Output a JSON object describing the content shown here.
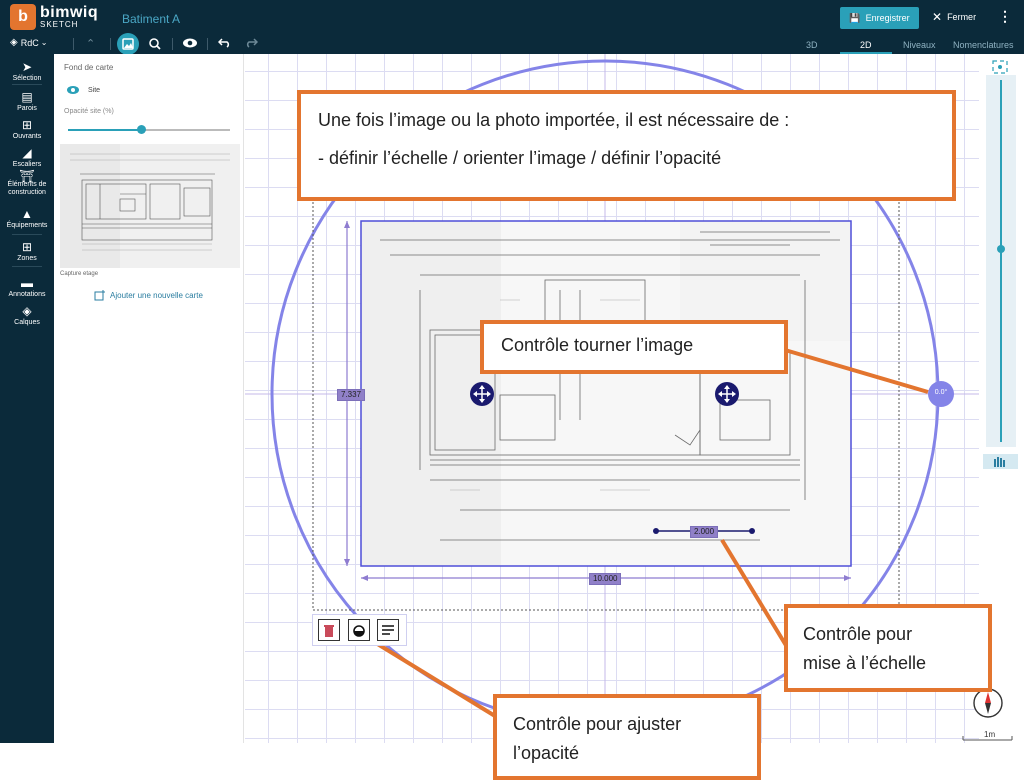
{
  "app": {
    "brand": "bimwiq",
    "brand_sub": "SKETCH",
    "project": "Batiment A"
  },
  "header": {
    "save_label": "Enregistrer",
    "close_label": "Fermer",
    "menu_icon": "kebab-icon"
  },
  "toolbar": {
    "level_select": "RdC"
  },
  "view_tabs": {
    "t3d": "3D",
    "t2d": "2D",
    "levels": "Niveaux",
    "nomenclatures": "Nomenclatures"
  },
  "rail": {
    "selection": "Sélection",
    "parois": "Parois",
    "ouvrants": "Ouvrants",
    "escaliers": "Escaliers",
    "elements1": "Éléments de",
    "elements2": "construction",
    "equipements": "Équipements",
    "zones": "Zones",
    "annotations": "Annotations",
    "calques": "Calques"
  },
  "panel": {
    "title": "Fond de carte",
    "site_label": "Site",
    "opacity_label": "Opacité site (%)",
    "opacity_value": 0.45,
    "caption": "Capture etage",
    "add_map": "Ajouter une nouvelle carte"
  },
  "canvas": {
    "dim_height": "7.337",
    "dim_width": "10.000",
    "dim_scale": "2.000",
    "rotation": "0.0°",
    "scale_bar": "1m"
  },
  "annotations": {
    "top_line1": "Une fois l’image ou la photo importée, il est nécessaire de :",
    "top_line2": "- définir l’échelle / orienter l’image / définir l’opacité",
    "rotate": "Contrôle tourner l’image",
    "scale_line1": "Contrôle pour",
    "scale_line2": "mise à l’échelle",
    "opacity_line1": "Contrôle pour ajuster",
    "opacity_line2": "l’opacité"
  },
  "colors": {
    "topbar": "#0b2a3a",
    "accent": "#2aa0b8",
    "orange": "#e3752f",
    "purple": "#8484e8"
  }
}
